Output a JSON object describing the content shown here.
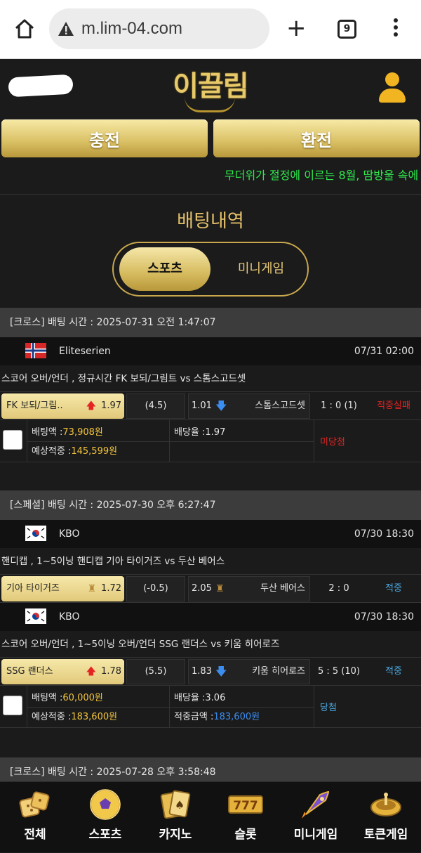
{
  "browser": {
    "url": "m.lim-04.com",
    "tab_count": "9"
  },
  "header": {
    "logo": "이끌림",
    "charge_label": "충전",
    "exchange_label": "환전",
    "marquee": "무더위가 절정에 이르는 8월, 땀방울 속에"
  },
  "page": {
    "title": "배팅내역",
    "tabs": [
      "스포츠",
      "미니게임"
    ],
    "active_tab": "스포츠"
  },
  "bets": [
    {
      "header": "[크로스] 배팅 시간 : 2025-07-31 오전 1:47:07",
      "games": [
        {
          "league": "Eliteserien",
          "league_flag": "norway-flag-icon",
          "time": "07/31 02:00",
          "market": "스코어 오버/언더 , 정규시간 FK 보되/그림트  vs  스톰스고드셋",
          "home": "FK 보되/그림..",
          "home_odds": "1.97",
          "line": "(4.5)",
          "away_odds": "1.01",
          "away": "스톰스고드셋",
          "score": "1 : 0 (1)",
          "result": "적중실패",
          "result_color": "#e42323"
        }
      ],
      "bet_amount_label": "배팅액 :",
      "bet_amount": "73,908원",
      "rate_label": "배당율 :",
      "rate": "1.97",
      "expected_label": "예상적중 :",
      "expected": "145,599원",
      "win_label": "",
      "win_amount": "",
      "status": "미당첨",
      "status_color": "#e42323"
    },
    {
      "header": "[스페셜] 배팅 시간 : 2025-07-30 오후 6:27:47",
      "games": [
        {
          "league": "KBO",
          "league_flag": "korea-flag-icon",
          "time": "07/30 18:30",
          "market": "핸디캡 , 1~5이닝 핸디캡 기아 타이거즈  vs  두산 베어스",
          "home": "기아 타이거즈",
          "home_odds": "1.72",
          "line": "(-0.5)",
          "away_odds": "2.05",
          "away": "두산 베어스",
          "score": "2 : 0",
          "result": "적중",
          "result_color": "#4aa8e0"
        },
        {
          "league": "KBO",
          "league_flag": "korea-flag-icon",
          "time": "07/30 18:30",
          "market": "스코어 오버/언더 , 1~5이닝 오버/언더 SSG 랜더스  vs  키움 히어로즈",
          "home": "SSG 랜더스",
          "home_odds": "1.78",
          "line": "(5.5)",
          "away_odds": "1.83",
          "away": "키움 히어로즈",
          "score": "5 : 5 (10)",
          "result": "적중",
          "result_color": "#4aa8e0"
        }
      ],
      "bet_amount_label": "배팅액 :",
      "bet_amount": "60,000원",
      "rate_label": "배당율 :",
      "rate": "3.06",
      "expected_label": "예상적중 :",
      "expected": "183,600원",
      "win_label": "적중금액 :",
      "win_amount": "183,600원",
      "status": "당첨",
      "status_color": "#4aa8e0"
    },
    {
      "header": "[크로스] 배팅 시간 : 2025-07-28 오후 3:58:48"
    }
  ],
  "nav": [
    {
      "label": "전체",
      "icon": "dice-icon"
    },
    {
      "label": "스포츠",
      "icon": "soccer-ball-icon"
    },
    {
      "label": "카지노",
      "icon": "cards-icon"
    },
    {
      "label": "슬롯",
      "icon": "slot-777-icon"
    },
    {
      "label": "미니게임",
      "icon": "rocket-icon"
    },
    {
      "label": "토큰게임",
      "icon": "roulette-icon"
    }
  ]
}
